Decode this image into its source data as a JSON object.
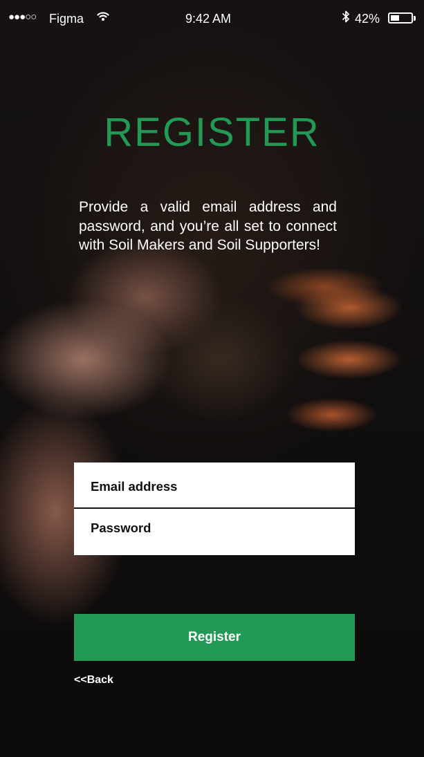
{
  "status_bar": {
    "signal": "●●●○○",
    "carrier": "Figma",
    "time": "9:42 AM",
    "bluetooth_icon": "bluetooth-icon",
    "wifi_icon": "wifi-icon",
    "battery_percent": "42%",
    "battery_level": 0.42
  },
  "page": {
    "title": "REGISTER",
    "description": "Provide a valid email address and password, and you’re all set to connect with Soil Makers and Soil Supporters!"
  },
  "form": {
    "email_placeholder": "Email address",
    "password_placeholder": "Password"
  },
  "actions": {
    "register_label": "Register",
    "back_label": "<<Back"
  },
  "colors": {
    "accent": "#229955",
    "text": "#ffffff",
    "field_background": "#ffffff"
  }
}
